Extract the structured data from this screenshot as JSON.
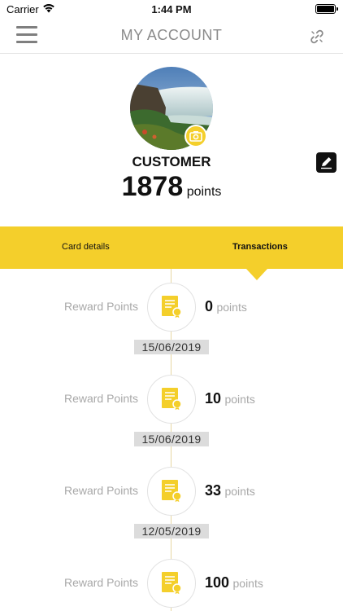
{
  "status_bar": {
    "carrier": "Carrier",
    "time": "1:44 PM"
  },
  "nav": {
    "title": "MY ACCOUNT"
  },
  "profile": {
    "name": "CUSTOMER",
    "points": "1878",
    "points_unit": "points"
  },
  "tabs": [
    {
      "label": "Card details",
      "active": false
    },
    {
      "label": "Transactions",
      "active": true
    }
  ],
  "transactions": [
    {
      "label": "Reward Points",
      "value": "0",
      "unit": "points",
      "date": "15/06/2019"
    },
    {
      "label": "Reward Points",
      "value": "10",
      "unit": "points",
      "date": "15/06/2019"
    },
    {
      "label": "Reward Points",
      "value": "33",
      "unit": "points",
      "date": "12/05/2019"
    },
    {
      "label": "Reward Points",
      "value": "100",
      "unit": "points",
      "date": ""
    }
  ],
  "colors": {
    "accent": "#f4cf2b",
    "muted_text": "#a8a8a8",
    "nav_title": "#8a8a8a"
  },
  "icons": [
    "menu-icon",
    "link-icon",
    "camera-icon",
    "edit-icon",
    "reward-certificate-icon",
    "wifi-icon",
    "battery-icon"
  ]
}
